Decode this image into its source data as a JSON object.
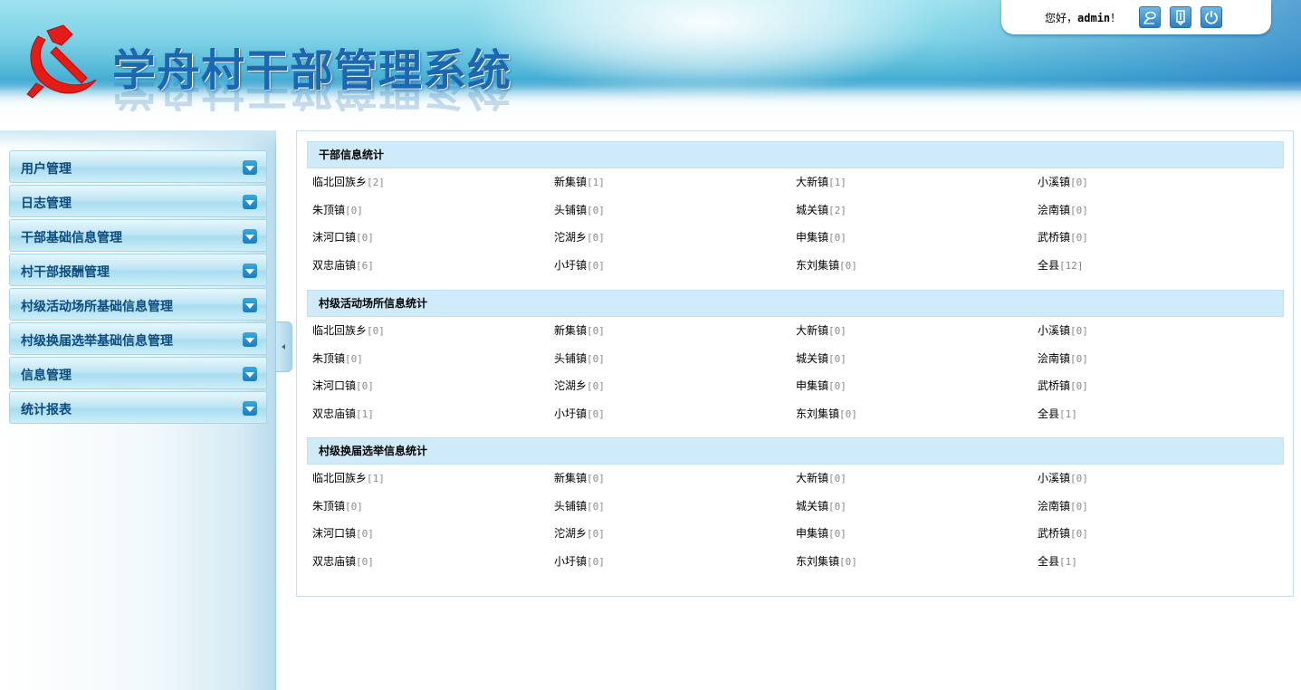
{
  "header": {
    "system_title": "学舟村干部管理系统",
    "greeting_prefix": "您好，",
    "username": "admin",
    "greeting_suffix": "！",
    "buttons": [
      {
        "name": "edit-profile-icon"
      },
      {
        "name": "notebook-icon"
      },
      {
        "name": "power-icon"
      }
    ],
    "emblem_color": "#e41b17"
  },
  "sidebar": {
    "items": [
      {
        "label": "用户管理"
      },
      {
        "label": "日志管理"
      },
      {
        "label": "干部基础信息管理"
      },
      {
        "label": "村干部报酬管理"
      },
      {
        "label": "村级活动场所基础信息管理"
      },
      {
        "label": "村级换届选举基础信息管理"
      },
      {
        "label": "信息管理"
      },
      {
        "label": "统计报表"
      }
    ]
  },
  "sections": [
    {
      "title": "干部信息统计",
      "items": [
        {
          "name": "临北回族乡",
          "count": "[2]"
        },
        {
          "name": "新集镇",
          "count": "[1]"
        },
        {
          "name": "大新镇",
          "count": "[1]"
        },
        {
          "name": "小溪镇",
          "count": "[0]"
        },
        {
          "name": "朱顶镇",
          "count": "[0]"
        },
        {
          "name": "头铺镇",
          "count": "[0]"
        },
        {
          "name": "城关镇",
          "count": "[2]"
        },
        {
          "name": "浍南镇",
          "count": "[0]"
        },
        {
          "name": "沫河口镇",
          "count": "[0]"
        },
        {
          "name": "沱湖乡",
          "count": "[0]"
        },
        {
          "name": "申集镇",
          "count": "[0]"
        },
        {
          "name": "武桥镇",
          "count": "[0]"
        },
        {
          "name": "双忠庙镇",
          "count": "[6]"
        },
        {
          "name": "小圩镇",
          "count": "[0]"
        },
        {
          "name": "东刘集镇",
          "count": "[0]"
        },
        {
          "name": "全县",
          "count": "[12]"
        }
      ]
    },
    {
      "title": "村级活动场所信息统计",
      "items": [
        {
          "name": "临北回族乡",
          "count": "[0]"
        },
        {
          "name": "新集镇",
          "count": "[0]"
        },
        {
          "name": "大新镇",
          "count": "[0]"
        },
        {
          "name": "小溪镇",
          "count": "[0]"
        },
        {
          "name": "朱顶镇",
          "count": "[0]"
        },
        {
          "name": "头铺镇",
          "count": "[0]"
        },
        {
          "name": "城关镇",
          "count": "[0]"
        },
        {
          "name": "浍南镇",
          "count": "[0]"
        },
        {
          "name": "沫河口镇",
          "count": "[0]"
        },
        {
          "name": "沱湖乡",
          "count": "[0]"
        },
        {
          "name": "申集镇",
          "count": "[0]"
        },
        {
          "name": "武桥镇",
          "count": "[0]"
        },
        {
          "name": "双忠庙镇",
          "count": "[1]"
        },
        {
          "name": "小圩镇",
          "count": "[0]"
        },
        {
          "name": "东刘集镇",
          "count": "[0]"
        },
        {
          "name": "全县",
          "count": "[1]"
        }
      ]
    },
    {
      "title": "村级换届选举信息统计",
      "items": [
        {
          "name": "临北回族乡",
          "count": "[1]"
        },
        {
          "name": "新集镇",
          "count": "[0]"
        },
        {
          "name": "大新镇",
          "count": "[0]"
        },
        {
          "name": "小溪镇",
          "count": "[0]"
        },
        {
          "name": "朱顶镇",
          "count": "[0]"
        },
        {
          "name": "头铺镇",
          "count": "[0]"
        },
        {
          "name": "城关镇",
          "count": "[0]"
        },
        {
          "name": "浍南镇",
          "count": "[0]"
        },
        {
          "name": "沫河口镇",
          "count": "[0]"
        },
        {
          "name": "沱湖乡",
          "count": "[0]"
        },
        {
          "name": "申集镇",
          "count": "[0]"
        },
        {
          "name": "武桥镇",
          "count": "[0]"
        },
        {
          "name": "双忠庙镇",
          "count": "[0]"
        },
        {
          "name": "小圩镇",
          "count": "[0]"
        },
        {
          "name": "东刘集镇",
          "count": "[0]"
        },
        {
          "name": "全县",
          "count": "[1]"
        }
      ]
    }
  ]
}
